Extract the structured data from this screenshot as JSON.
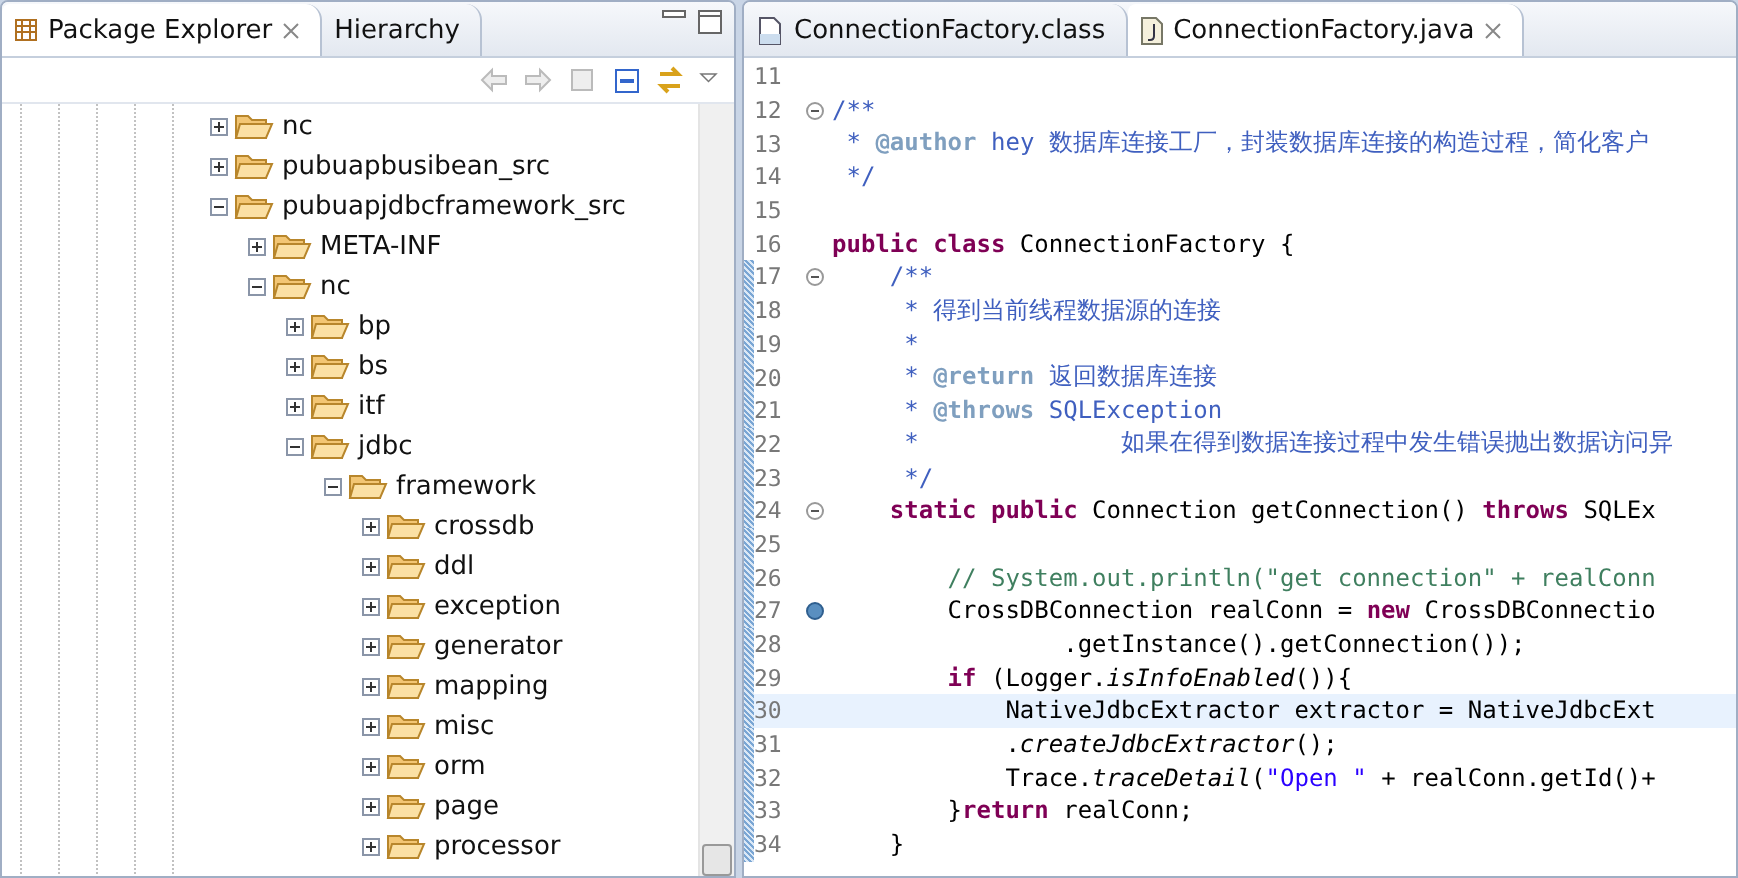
{
  "explorer": {
    "tabs": [
      {
        "label": "Package Explorer",
        "selected": true
      },
      {
        "label": "Hierarchy",
        "selected": false
      }
    ],
    "tree": [
      {
        "label": "nc",
        "expanded": false
      },
      {
        "label": "pubuapbusibean_src",
        "expanded": false
      },
      {
        "label": "pubuapjdbcframework_src",
        "expanded": true,
        "children": [
          {
            "label": "META-INF",
            "expanded": false
          },
          {
            "label": "nc",
            "expanded": true,
            "children": [
              {
                "label": "bp",
                "expanded": false
              },
              {
                "label": "bs",
                "expanded": false
              },
              {
                "label": "itf",
                "expanded": false
              },
              {
                "label": "jdbc",
                "expanded": true,
                "children": [
                  {
                    "label": "framework",
                    "expanded": true,
                    "children": [
                      {
                        "label": "crossdb",
                        "expanded": false
                      },
                      {
                        "label": "ddl",
                        "expanded": false
                      },
                      {
                        "label": "exception",
                        "expanded": false
                      },
                      {
                        "label": "generator",
                        "expanded": false
                      },
                      {
                        "label": "mapping",
                        "expanded": false
                      },
                      {
                        "label": "misc",
                        "expanded": false
                      },
                      {
                        "label": "orm",
                        "expanded": false
                      },
                      {
                        "label": "page",
                        "expanded": false
                      },
                      {
                        "label": "processor",
                        "expanded": false
                      }
                    ]
                  }
                ]
              }
            ]
          }
        ]
      }
    ]
  },
  "editor": {
    "tabs": [
      {
        "label": "ConnectionFactory.class",
        "kind": "class",
        "selected": false
      },
      {
        "label": "ConnectionFactory.java",
        "kind": "java",
        "selected": true
      }
    ],
    "lines": [
      {
        "number": "11",
        "fold": false,
        "marker": false,
        "changed": false,
        "current": false
      },
      {
        "number": "12",
        "fold": true,
        "marker": false,
        "changed": false,
        "current": false,
        "tokens": [
          {
            "kind": "doc",
            "text": "/**"
          }
        ]
      },
      {
        "number": "13",
        "fold": false,
        "marker": false,
        "changed": false,
        "current": false,
        "tokens": [
          {
            "kind": "doc",
            "text": " * "
          },
          {
            "kind": "tag",
            "text": "@author"
          },
          {
            "kind": "doc",
            "text": " hey 数据库连接工厂，封装数据库连接的构造过程，简化客户"
          }
        ]
      },
      {
        "number": "14",
        "fold": false,
        "marker": false,
        "changed": false,
        "current": false,
        "tokens": [
          {
            "kind": "doc",
            "text": " */"
          }
        ]
      },
      {
        "number": "15",
        "fold": false,
        "marker": false,
        "changed": false,
        "current": false
      },
      {
        "number": "16",
        "fold": false,
        "marker": false,
        "changed": false,
        "current": false,
        "tokens": [
          {
            "kind": "kw",
            "text": "public class"
          },
          {
            "kind": "plain",
            "text": " ConnectionFactory {"
          }
        ]
      },
      {
        "number": "17",
        "fold": true,
        "marker": false,
        "changed": true,
        "current": false,
        "tokens": [
          {
            "kind": "doc",
            "text": "    /**"
          }
        ]
      },
      {
        "number": "18",
        "fold": false,
        "marker": false,
        "changed": true,
        "current": false,
        "tokens": [
          {
            "kind": "doc",
            "text": "     * 得到当前线程数据源的连接"
          }
        ]
      },
      {
        "number": "19",
        "fold": false,
        "marker": false,
        "changed": true,
        "current": false,
        "tokens": [
          {
            "kind": "doc",
            "text": "     *"
          }
        ]
      },
      {
        "number": "20",
        "fold": false,
        "marker": false,
        "changed": true,
        "current": false,
        "tokens": [
          {
            "kind": "doc",
            "text": "     * "
          },
          {
            "kind": "tag",
            "text": "@return"
          },
          {
            "kind": "doc",
            "text": " 返回数据库连接"
          }
        ]
      },
      {
        "number": "21",
        "fold": false,
        "marker": false,
        "changed": true,
        "current": false,
        "tokens": [
          {
            "kind": "doc",
            "text": "     * "
          },
          {
            "kind": "tag",
            "text": "@throws"
          },
          {
            "kind": "doc",
            "text": " SQLException"
          }
        ]
      },
      {
        "number": "22",
        "fold": false,
        "marker": false,
        "changed": true,
        "current": false,
        "tokens": [
          {
            "kind": "doc",
            "text": "     *              如果在得到数据连接过程中发生错误抛出数据访问异"
          }
        ]
      },
      {
        "number": "23",
        "fold": false,
        "marker": false,
        "changed": true,
        "current": false,
        "tokens": [
          {
            "kind": "doc",
            "text": "     */"
          }
        ]
      },
      {
        "number": "24",
        "fold": true,
        "marker": false,
        "changed": true,
        "current": false,
        "tokens": [
          {
            "kind": "kw",
            "text": "    static public"
          },
          {
            "kind": "plain",
            "text": " Connection getConnection() "
          },
          {
            "kind": "kw",
            "text": "throws"
          },
          {
            "kind": "plain",
            "text": " SQLEx"
          }
        ]
      },
      {
        "number": "25",
        "fold": false,
        "marker": false,
        "changed": true,
        "current": false
      },
      {
        "number": "26",
        "fold": false,
        "marker": false,
        "changed": true,
        "current": false,
        "tokens": [
          {
            "kind": "comment",
            "text": "        // System.out.println(\"get connection\" + realConn"
          }
        ]
      },
      {
        "number": "27",
        "fold": false,
        "marker": true,
        "changed": true,
        "current": false,
        "tokens": [
          {
            "kind": "plain",
            "text": "        CrossDBConnection realConn = "
          },
          {
            "kind": "kw",
            "text": "new"
          },
          {
            "kind": "plain",
            "text": " CrossDBConnectio"
          }
        ]
      },
      {
        "number": "28",
        "fold": false,
        "marker": false,
        "changed": true,
        "current": false,
        "tokens": [
          {
            "kind": "plain",
            "text": "                .getInstance().getConnection());"
          }
        ]
      },
      {
        "number": "29",
        "fold": false,
        "marker": false,
        "changed": true,
        "current": false,
        "tokens": [
          {
            "kind": "kw",
            "text": "        if"
          },
          {
            "kind": "plain",
            "text": " (Logger."
          },
          {
            "kind": "italic",
            "text": "isInfoEnabled"
          },
          {
            "kind": "plain",
            "text": "()){"
          }
        ]
      },
      {
        "number": "30",
        "fold": false,
        "marker": false,
        "changed": true,
        "current": true,
        "tokens": [
          {
            "kind": "plain",
            "text": "            NativeJdbcExtractor extractor = NativeJdbcExt"
          }
        ]
      },
      {
        "number": "31",
        "fold": false,
        "marker": false,
        "changed": true,
        "current": false,
        "tokens": [
          {
            "kind": "plain",
            "text": "            ."
          },
          {
            "kind": "italic",
            "text": "createJdbcExtractor"
          },
          {
            "kind": "plain",
            "text": "();"
          }
        ]
      },
      {
        "number": "32",
        "fold": false,
        "marker": false,
        "changed": true,
        "current": false,
        "tokens": [
          {
            "kind": "plain",
            "text": "            Trace."
          },
          {
            "kind": "italic",
            "text": "traceDetail"
          },
          {
            "kind": "plain",
            "text": "("
          },
          {
            "kind": "str",
            "text": "\"Open \""
          },
          {
            "kind": "plain",
            "text": " + realConn.getId()+"
          }
        ]
      },
      {
        "number": "33",
        "fold": false,
        "marker": false,
        "changed": true,
        "current": false,
        "tokens": [
          {
            "kind": "plain",
            "text": "        }"
          },
          {
            "kind": "kw",
            "text": "return"
          },
          {
            "kind": "plain",
            "text": " realConn;"
          }
        ]
      },
      {
        "number": "34",
        "fold": false,
        "marker": false,
        "changed": true,
        "current": false,
        "tokens": [
          {
            "kind": "plain",
            "text": "    }"
          }
        ]
      }
    ]
  }
}
